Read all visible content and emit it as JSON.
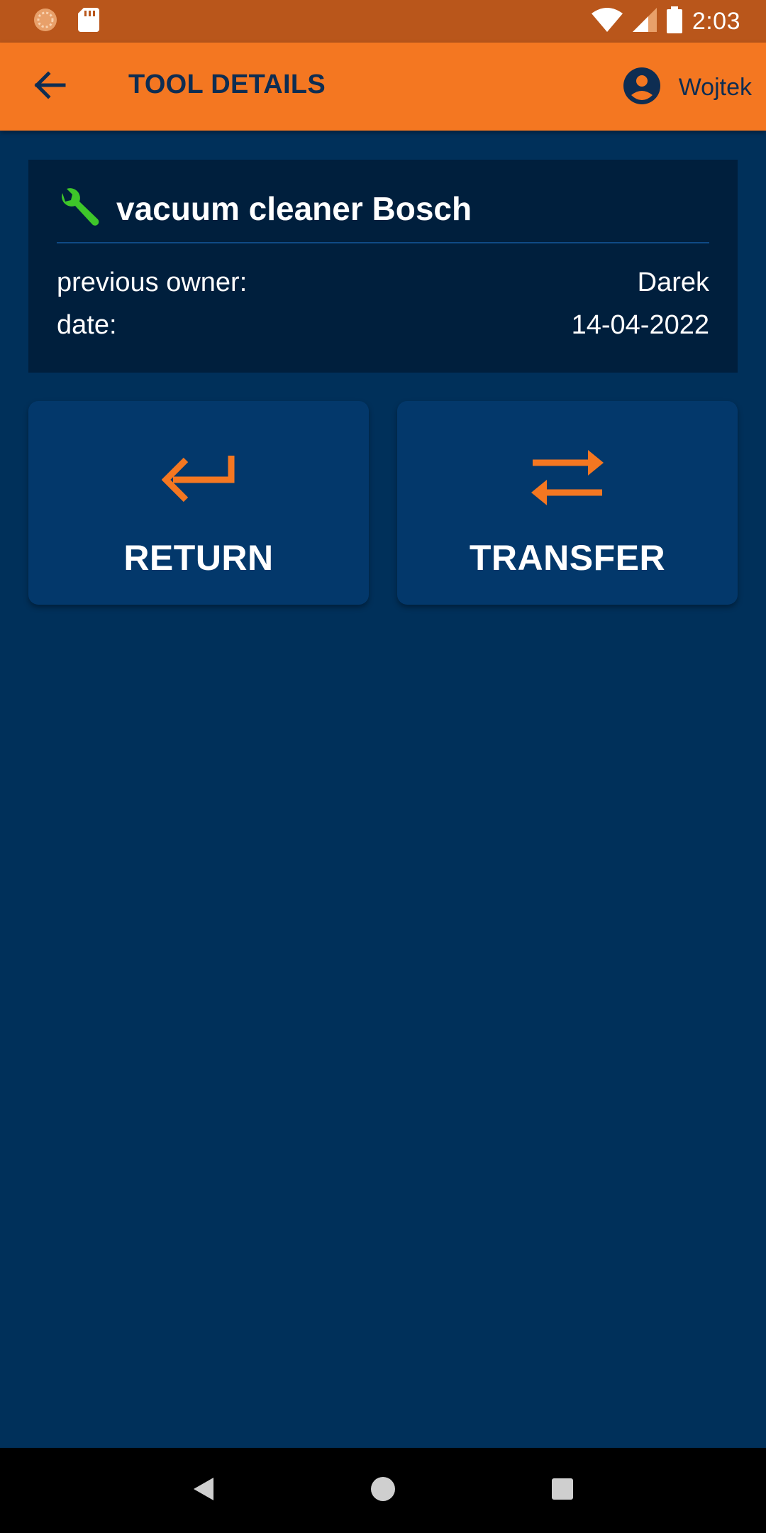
{
  "status_bar": {
    "time": "2:03",
    "icons": [
      "app-notification-icon",
      "sd-card-icon",
      "wifi-icon",
      "signal-icon",
      "battery-icon"
    ]
  },
  "app_bar": {
    "title": "TOOL DETAILS",
    "user_name": "Wojtek",
    "back_icon": "arrow-back-icon",
    "user_icon": "account-circle-icon"
  },
  "tool": {
    "name": "vacuum cleaner Bosch",
    "icon": "wrench-icon",
    "previous_owner_label": "previous owner:",
    "previous_owner": "Darek",
    "date_label": "date:",
    "date": "14-04-2022"
  },
  "actions": {
    "return_label": "RETURN",
    "transfer_label": "TRANSFER"
  },
  "nav_bar": {
    "icons": [
      "back-triangle-icon",
      "home-circle-icon",
      "recents-square-icon"
    ]
  },
  "colors": {
    "status_bar": "#b9561b",
    "app_bar": "#f47721",
    "background": "#00305a",
    "card": "#001f3d",
    "action_button": "#03386b",
    "accent_orange": "#f47721",
    "wrench_green": "#3ec62a",
    "title_text": "#0e2d52"
  }
}
